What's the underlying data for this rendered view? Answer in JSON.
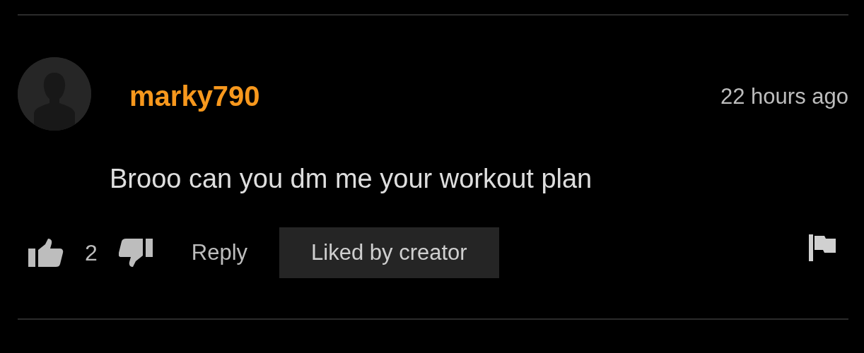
{
  "comment": {
    "username": "marky790",
    "time": "22 hours ago",
    "text": "Brooo can you dm me your workout plan",
    "likes": "2",
    "reply": "Reply",
    "badge": "Liked by creator"
  }
}
